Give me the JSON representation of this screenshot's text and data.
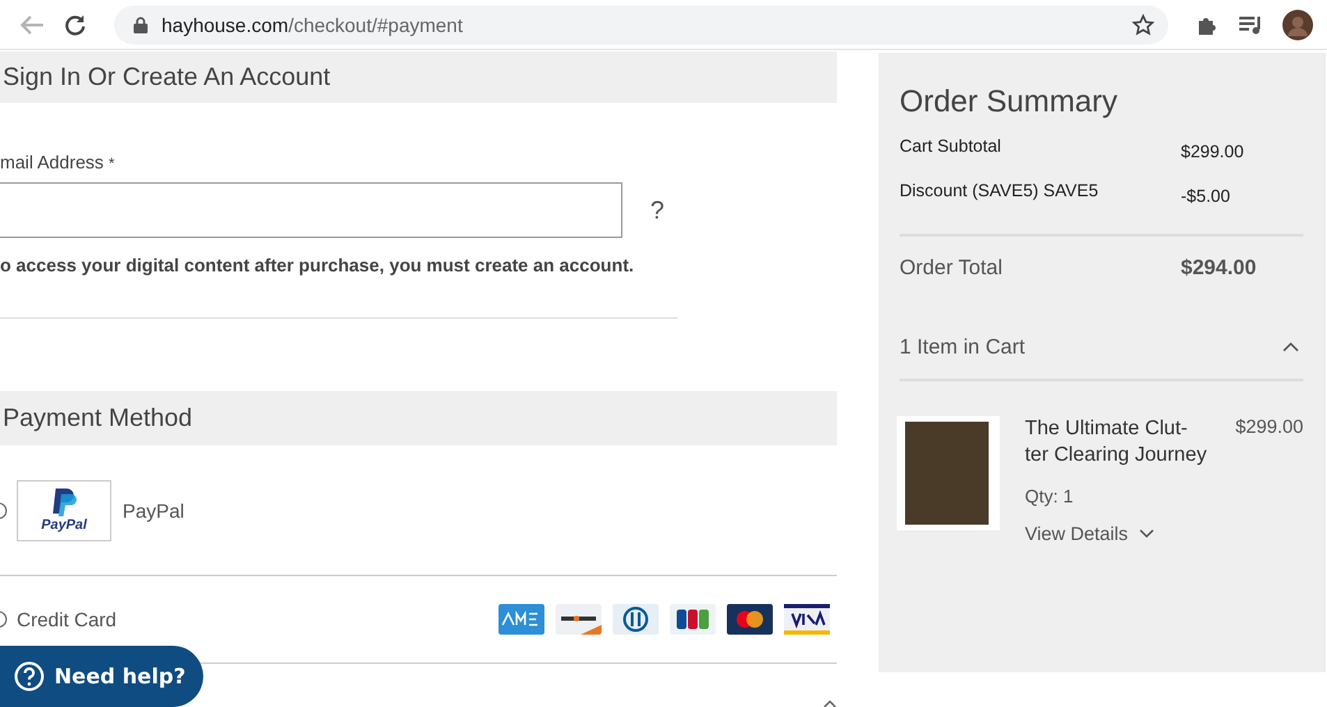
{
  "browser": {
    "url_host": "hayhouse.com",
    "url_path": "/checkout/#payment"
  },
  "account": {
    "title": "Sign In Or Create An Account",
    "email_label": "mail Address",
    "required_mark": "*",
    "help": "?",
    "note": "o access your digital content after purchase, you must create an account."
  },
  "payment": {
    "title": "Payment Method",
    "methods": [
      {
        "kind": "paypal",
        "label": "PayPal",
        "logo_text": "PayPal",
        "selected": false
      },
      {
        "kind": "card",
        "label": "Credit Card",
        "selected": false
      }
    ]
  },
  "help_button": {
    "label": "Need help?"
  },
  "summary": {
    "title": "Order Summary",
    "lines": [
      {
        "label": "Cart Subtotal",
        "value": "$299.00"
      },
      {
        "label": "Discount (SAVE5) SAVE5",
        "value": "-$5.00"
      }
    ],
    "total_label": "Order Total",
    "total_value": "$294.00",
    "cart_label": "1 Item in Cart",
    "cart_expanded": true,
    "items": [
      {
        "name": "The Ultimate Clut-ter Clearing Journey",
        "price": "$299.00",
        "qty": "Qty: 1",
        "details": "View Details"
      }
    ]
  }
}
